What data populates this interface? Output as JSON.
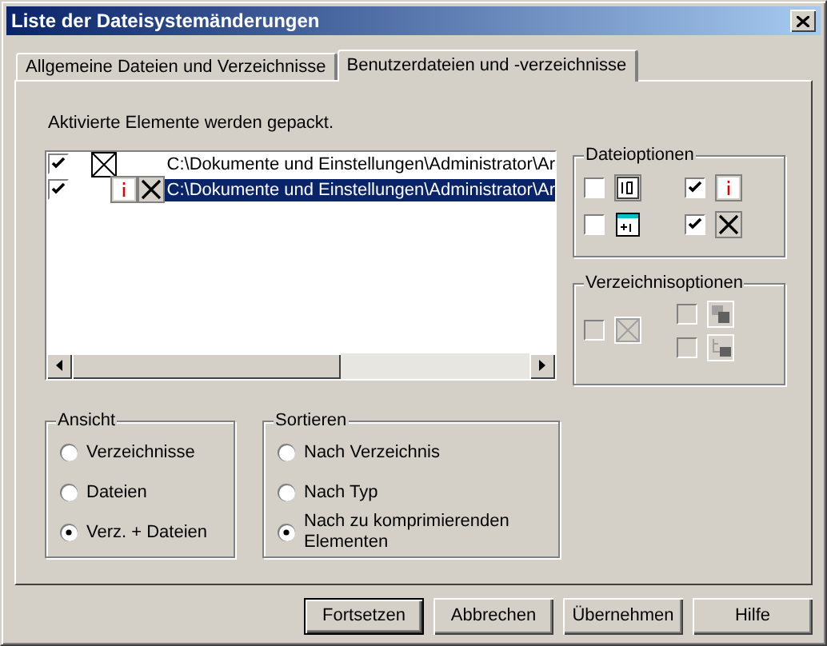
{
  "window": {
    "title": "Liste der Dateisystemänderungen"
  },
  "tabs": [
    {
      "label": "Allgemeine Dateien und Verzeichnisse",
      "selected": false
    },
    {
      "label": "Benutzerdateien und -verzeichnisse",
      "selected": true
    }
  ],
  "info_text": "Aktivierte Elemente werden gepackt.",
  "list": {
    "rows": [
      {
        "kind": "directory",
        "checked": true,
        "selected": false,
        "path": "C:\\Dokumente und Einstellungen\\Administrator\\Ar"
      },
      {
        "kind": "file",
        "checked": true,
        "selected": true,
        "path": "C:\\Dokumente und Einstellungen\\Administrator\\Ar"
      }
    ]
  },
  "file_options": {
    "title": "Dateioptionen",
    "items": [
      {
        "kind": "size",
        "checked": false,
        "disabled": false
      },
      {
        "kind": "info",
        "checked": true,
        "disabled": false
      },
      {
        "kind": "date",
        "checked": false,
        "disabled": false
      },
      {
        "kind": "cross",
        "checked": true,
        "disabled": false
      }
    ]
  },
  "dir_options": {
    "title": "Verzeichnisoptionen",
    "items": [
      {
        "kind": "xbox",
        "checked": false,
        "disabled": true
      },
      {
        "kind": "stack",
        "checked": false,
        "disabled": true
      },
      {
        "kind": "tree",
        "checked": false,
        "disabled": true
      }
    ]
  },
  "view": {
    "title": "Ansicht",
    "options": [
      {
        "label": "Verzeichnisse",
        "selected": false
      },
      {
        "label": "Dateien",
        "selected": false
      },
      {
        "label": "Verz. + Dateien",
        "selected": true
      }
    ]
  },
  "sort": {
    "title": "Sortieren",
    "options": [
      {
        "label": "Nach Verzeichnis",
        "selected": false
      },
      {
        "label": "Nach Typ",
        "selected": false
      },
      {
        "label": "Nach zu komprimierenden Elementen",
        "selected": true
      }
    ]
  },
  "buttons": [
    {
      "label": "Fortsetzen",
      "default": true
    },
    {
      "label": "Abbrechen",
      "default": false
    },
    {
      "label": "Übernehmen",
      "default": false
    },
    {
      "label": "Hilfe",
      "default": false
    }
  ]
}
